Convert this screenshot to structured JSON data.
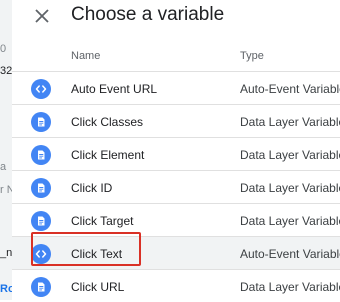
{
  "dialog": {
    "title": "Choose a variable",
    "close_icon": "close-icon",
    "columns": {
      "name": "Name",
      "type": "Type"
    },
    "rows": [
      {
        "name": "Auto Event URL",
        "type": "Auto-Event Variable",
        "icon": "code-icon"
      },
      {
        "name": "Click Classes",
        "type": "Data Layer Variable",
        "icon": "document-icon"
      },
      {
        "name": "Click Element",
        "type": "Data Layer Variable",
        "icon": "document-icon"
      },
      {
        "name": "Click ID",
        "type": "Data Layer Variable",
        "icon": "document-icon"
      },
      {
        "name": "Click Target",
        "type": "Data Layer Variable",
        "icon": "document-icon"
      },
      {
        "name": "Click Text",
        "type": "Auto-Event Variable",
        "icon": "code-icon",
        "highlighted": true
      },
      {
        "name": "Click URL",
        "type": "Data Layer Variable",
        "icon": "document-icon"
      }
    ]
  },
  "underlay": {
    "fragments": [
      "0",
      "32",
      "a",
      "r N",
      "_na",
      "Ro"
    ]
  },
  "colors": {
    "icon_blue": "#4285f4",
    "highlight_red": "#d93025",
    "selected_row": "#f1f3f4"
  }
}
